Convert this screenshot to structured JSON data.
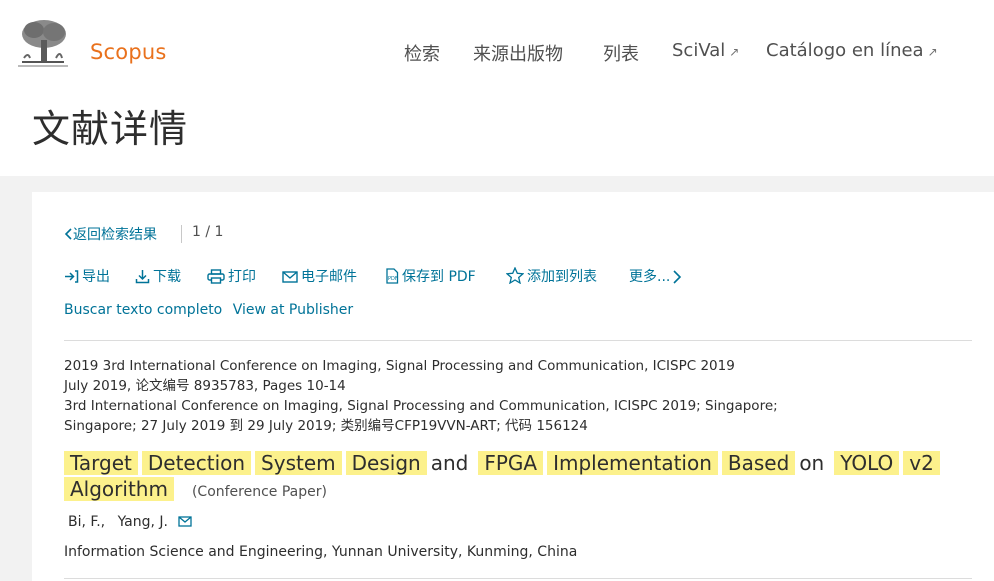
{
  "header": {
    "brand": "Scopus",
    "nav": [
      {
        "label": "检索",
        "external": false
      },
      {
        "label": "来源出版物",
        "external": false
      },
      {
        "label": "列表",
        "external": false
      },
      {
        "label": "SciVal",
        "external": true
      },
      {
        "label": "Catálogo en línea",
        "external": true
      }
    ],
    "external_icon": "↗"
  },
  "page_title": "文献详情",
  "results_nav": {
    "back_label": "返回检索结果",
    "pager": "1 / 1"
  },
  "actions": [
    {
      "label": "导出",
      "icon": "export-icon"
    },
    {
      "label": "下载",
      "icon": "download-icon"
    },
    {
      "label": "打印",
      "icon": "print-icon"
    },
    {
      "label": "电子邮件",
      "icon": "email-icon"
    },
    {
      "label": "保存到 PDF",
      "icon": "pdf-icon"
    },
    {
      "label": "添加到列表",
      "icon": "star-icon"
    },
    {
      "label": "更多...",
      "icon": "chevron-right-icon"
    }
  ],
  "fulltext_links": [
    "Buscar texto completo",
    "View at Publisher"
  ],
  "source_meta": [
    "2019 3rd International Conference on Imaging, Signal Processing and Communication, ICISPC 2019",
    "July 2019, 论文编号 8935783, Pages 10-14",
    "3rd International Conference on Imaging, Signal Processing and Communication, ICISPC 2019; Singapore;",
    "Singapore; 27 July 2019 到 29 July 2019; 类别编号CFP19VVN-ART; 代码 156124"
  ],
  "article": {
    "title_words": [
      {
        "w": "Target",
        "hl": true
      },
      {
        "w": "Detection",
        "hl": true
      },
      {
        "w": "System",
        "hl": true
      },
      {
        "w": "Design",
        "hl": true
      },
      {
        "w": "and",
        "hl": false
      },
      {
        "w": "FPGA",
        "hl": true
      },
      {
        "w": "Implementation",
        "hl": true
      },
      {
        "w": "Based",
        "hl": true
      },
      {
        "w": "on",
        "hl": false
      },
      {
        "w": "YOLO",
        "hl": true
      },
      {
        "w": "v2",
        "hl": true
      },
      {
        "w": "Algorithm",
        "hl": true
      }
    ],
    "doc_type": "(Conference Paper)",
    "authors": [
      "Bi, F.,",
      "Yang, J."
    ],
    "affiliation": "Information Science and Engineering, Yunnan University, Kunming, China"
  },
  "colors": {
    "brand": "#e9711c",
    "link": "#007398",
    "highlight": "#fcf18c"
  }
}
